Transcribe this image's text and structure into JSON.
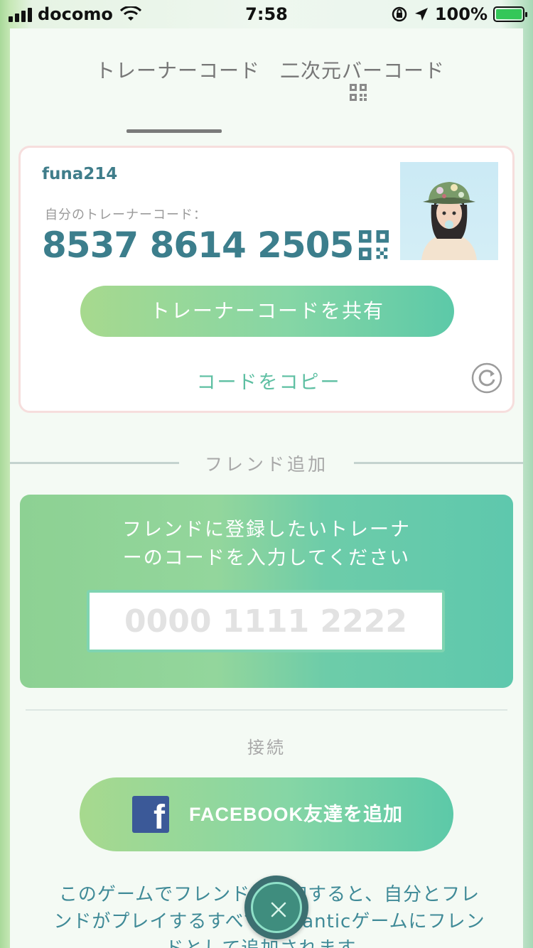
{
  "status_bar": {
    "carrier": "docomo",
    "time": "7:58",
    "battery_text": "100%"
  },
  "tabs": [
    {
      "label": "トレーナーコード",
      "active": true
    },
    {
      "label": "二次元バーコード",
      "active": false
    }
  ],
  "card": {
    "username": "funa214",
    "mycode_label": "自分のトレーナーコード：",
    "mycode": "8537 8614 2505",
    "share_button": "トレーナーコードを共有",
    "copy_link": "コードをコピー"
  },
  "add_friend": {
    "section_label": "フレンド追加",
    "instruction_line1": "フレンドに登録したいトレーナ",
    "instruction_line2": "ーのコードを入力してください",
    "input_placeholder": "0000 1111 2222",
    "input_value": ""
  },
  "connect": {
    "section_label": "接続",
    "facebook_button": "FACEBOOK友達を追加"
  },
  "info": {
    "line1": "このゲームでフレンドを追加すると、自分とフレ",
    "line2": "ンドがプレイするすべてのNianticゲームにフレン",
    "line3": "ドとして追加されます。"
  },
  "colors": {
    "accent_green": "#86d6a5",
    "accent_teal": "#5cc9a8",
    "code_text": "#3c7e8c",
    "facebook_blue": "#3b5998"
  },
  "icons": {
    "tab_qr": "qr-code-icon",
    "card_qr": "qr-code-icon",
    "refresh": "refresh-icon",
    "close": "close-icon",
    "facebook": "facebook-icon"
  }
}
